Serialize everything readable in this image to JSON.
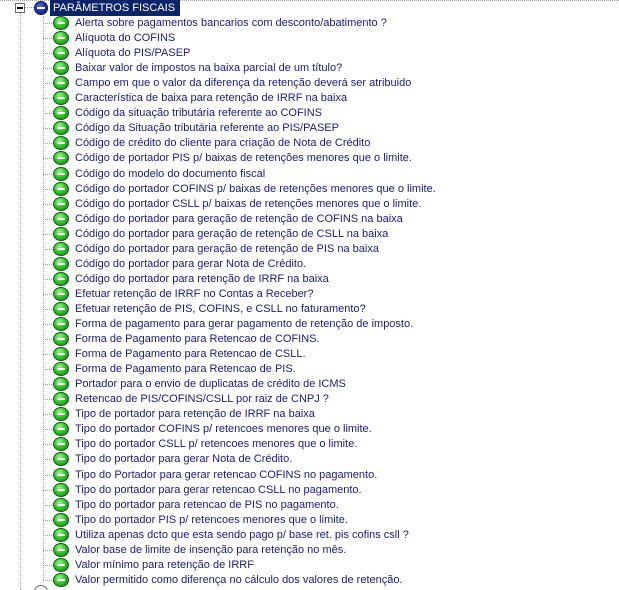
{
  "tree": {
    "root": {
      "label": "PARÂMETROS FISCAIS",
      "expanded": true,
      "selected": true
    },
    "items": [
      {
        "label": "Alerta sobre pagamentos bancarios com desconto/abatimento ?"
      },
      {
        "label": "Alíquota do COFINS"
      },
      {
        "label": "Alíquota do PIS/PASEP"
      },
      {
        "label": "Baixar valor de impostos na baixa parcial de um título?"
      },
      {
        "label": "Campo em que o valor da diferença da retenção deverá ser atribuido"
      },
      {
        "label": "Característica de baixa para retenção de IRRF na baixa"
      },
      {
        "label": "Código da situação tributária referente ao COFINS"
      },
      {
        "label": "Código da Situação tributária referente ao PIS/PASEP"
      },
      {
        "label": "Código de crédito do cliente para criação de Nota de Crédito"
      },
      {
        "label": "Código de portador PIS p/ baixas de retenções menores que o limite."
      },
      {
        "label": "Código do modelo do documento fiscal"
      },
      {
        "label": "Código do portador COFINS p/ baixas de retenções menores que o limite."
      },
      {
        "label": "Código do portador CSLL p/ baixas de retenções menores que o limite."
      },
      {
        "label": "Código do portador para geração de retenção de COFINS na baixa"
      },
      {
        "label": "Código do portador para geração de retenção de CSLL na baixa"
      },
      {
        "label": "Código do portador para geração de retenção de PIS na baixa"
      },
      {
        "label": "Código do portador para gerar Nota de Crédito."
      },
      {
        "label": "Código do portador para retenção de IRRF na baixa"
      },
      {
        "label": "Efetuar retenção de IRRF no Contas a Receber?"
      },
      {
        "label": "Efetuar retenção de PIS, COFINS, e CSLL no faturamento?"
      },
      {
        "label": "Forma de pagamento para gerar pagamento de retenção de imposto."
      },
      {
        "label": "Forma de Pagamento para Retencao de COFINS."
      },
      {
        "label": "Forma de Pagamento para Retencao de CSLL."
      },
      {
        "label": "Forma de Pagamento para Retencao de PIS."
      },
      {
        "label": "Portador para o envio de duplicatas de crédito de ICMS"
      },
      {
        "label": "Retencao de PIS/COFINS/CSLL por raiz de CNPJ ?"
      },
      {
        "label": "Tipo de portador para retenção de IRRF na baixa"
      },
      {
        "label": "Tipo do portador COFINS p/ retencoes menores que o limite."
      },
      {
        "label": "Tipo do portador CSLL p/ retencoes menores que o limite."
      },
      {
        "label": "Tipo do portador para gerar Nota de Crédito."
      },
      {
        "label": "Tipo do Portador para gerar retencao COFINS no pagamento."
      },
      {
        "label": "Tipo do portador para gerar retencao CSLL no pagamento."
      },
      {
        "label": "Tipo do portador para retencao de PIS no pagamento."
      },
      {
        "label": "Tipo do portador PIS p/ retencoes menores que o limite."
      },
      {
        "label": "Utiliza apenas dcto que esta sendo pago p/ base ret. pis cofins csll ?"
      },
      {
        "label": "Valor base de limite de insenção para retenção no mês."
      },
      {
        "label": "Valor mínimo para retenção de IRRF"
      },
      {
        "label": "Valor permitido como diferença no cálculo dos valores de retenção."
      }
    ],
    "colors": {
      "selection_bg": "#0a246a",
      "selection_text": "#ffffff",
      "item_text": "#1a1a80",
      "leaf_icon": "#2fbf2a",
      "root_icon": "#1b2a9a"
    }
  }
}
